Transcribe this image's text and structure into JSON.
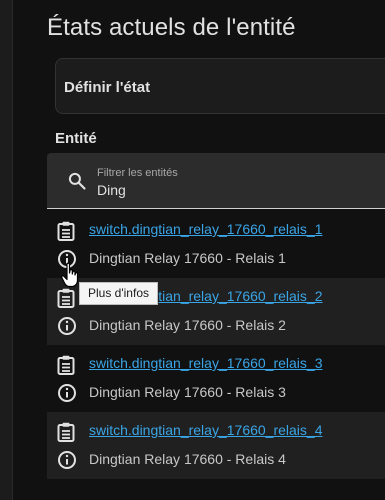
{
  "page": {
    "title": "États actuels de l'entité",
    "set_state_label": "Définir l'état",
    "entity_header": "Entité"
  },
  "filter": {
    "label": "Filtrer les entités",
    "value": "Ding",
    "icon": "search-icon"
  },
  "rows": [
    {
      "entity_id": "switch.dingtian_relay_17660_relais_1",
      "name": "Dingtian Relay 17660 - Relais 1"
    },
    {
      "entity_id": "switch.dingtian_relay_17660_relais_2",
      "name": "Dingtian Relay 17660 - Relais 2"
    },
    {
      "entity_id": "switch.dingtian_relay_17660_relais_3",
      "name": "Dingtian Relay 17660 - Relais 3"
    },
    {
      "entity_id": "switch.dingtian_relay_17660_relais_4",
      "name": "Dingtian Relay 17660 - Relais 4"
    }
  ],
  "tooltip": {
    "text": "Plus d'infos"
  },
  "colors": {
    "background": "#111111",
    "link": "#3aa5e6",
    "row_alt": "#202020"
  }
}
